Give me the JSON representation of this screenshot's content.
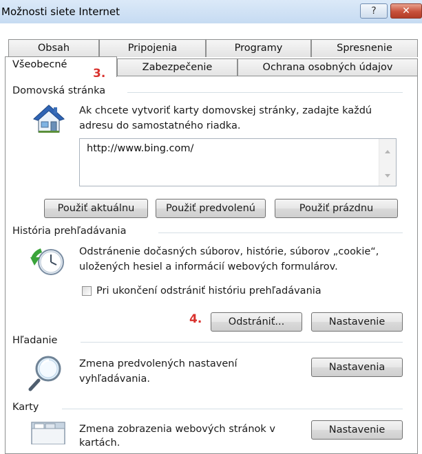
{
  "window": {
    "title": "Možnosti siete Internet",
    "help_label": "?",
    "close_label": "✕"
  },
  "tabs": {
    "row1": [
      "Obsah",
      "Pripojenia",
      "Programy",
      "Spresnenie"
    ],
    "row2": [
      "Všeobecné",
      "Zabezpečenie",
      "Ochrana osobných údajov"
    ],
    "active": "Všeobecné"
  },
  "annotations": {
    "step3": "3.",
    "step4": "4."
  },
  "home_page": {
    "title": "Domovská stránka",
    "icon": "house-icon",
    "description_line1": "Ak chcete vytvoriť karty domovskej stránky, zadajte každú",
    "description_line2": "adresu do samostatného riadka.",
    "url_value": "http://www.bing.com/",
    "buttons": {
      "use_current": "Použiť aktuálnu",
      "use_default": "Použiť predvolenú",
      "use_blank": "Použiť prázdnu"
    }
  },
  "history": {
    "title": "História prehľadávania",
    "icon": "clock-history-icon",
    "description_line1": "Odstránenie dočasných súborov, histórie, súborov „cookie“,",
    "description_line2": "uložených hesiel a informácií webových formulárov.",
    "checkbox_label": "Pri ukončení odstrániť históriu prehľadávania",
    "checkbox_checked": false,
    "buttons": {
      "delete": "Odstrániť...",
      "settings": "Nastavenie"
    }
  },
  "search": {
    "title": "Hľadanie",
    "icon": "magnifier-icon",
    "description_line1": "Zmena predvolených nastavení",
    "description_line2": "vyhľadávania.",
    "button": "Nastavenia"
  },
  "tabs_section": {
    "title": "Karty",
    "icon": "tabs-window-icon",
    "description_line1": "Zmena zobrazenia webových stránok v",
    "description_line2": "kartách.",
    "button": "Nastavenie"
  },
  "colors": {
    "annotation_red": "#d9322e",
    "titlebar_blue": "#c6dbf2"
  }
}
